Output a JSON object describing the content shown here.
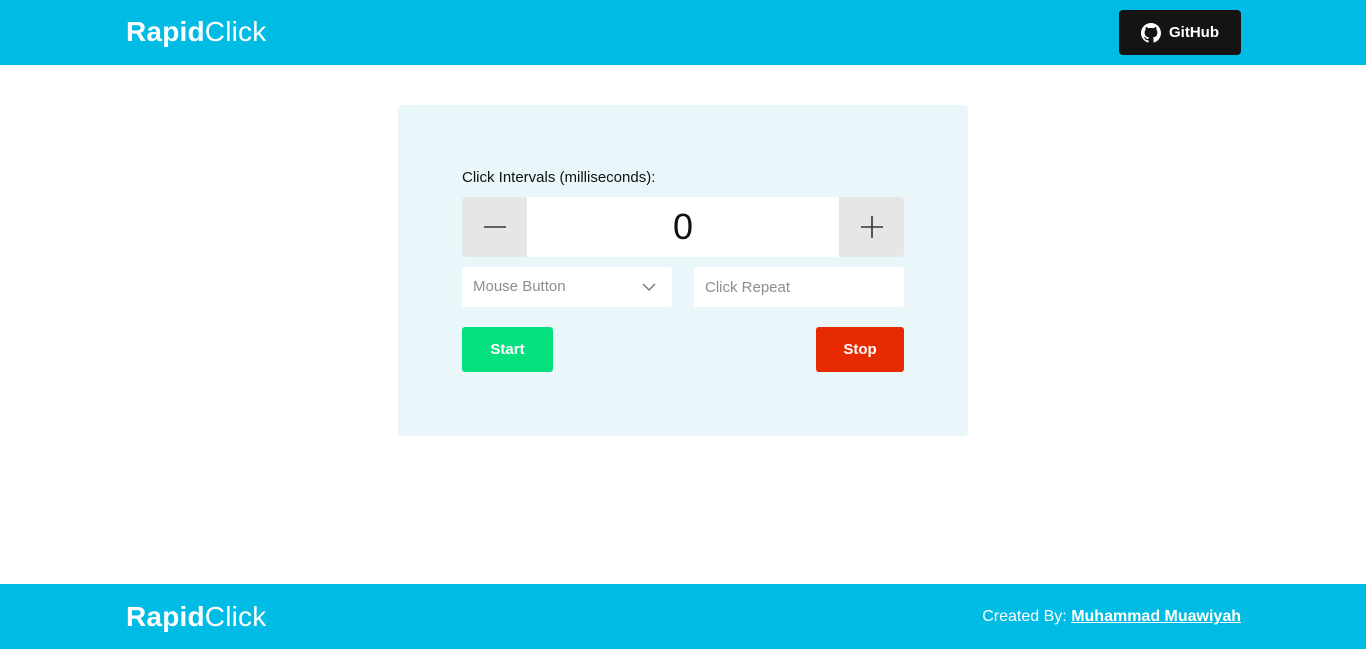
{
  "header": {
    "logo_bold": "Rapid",
    "logo_light": "Click",
    "github_label": "GitHub",
    "github_icon": "github-icon"
  },
  "form": {
    "interval_label": "Click Intervals (milliseconds):",
    "interval_value": "0",
    "minus_icon": "minus-icon",
    "plus_icon": "plus-icon",
    "mouse_button_placeholder": "Mouse Button",
    "click_repeat_placeholder": "Click Repeat",
    "start_label": "Start",
    "stop_label": "Stop"
  },
  "footer": {
    "logo_bold": "Rapid",
    "logo_light": "Click",
    "credit_prefix": "Created By:",
    "credit_name": "Muhammad Muawiyah"
  },
  "colors": {
    "brand": "#00bce4",
    "card_bg": "#e9f6fa",
    "start": "#05e17f",
    "stop": "#e82a00",
    "github_bg": "#141414"
  }
}
